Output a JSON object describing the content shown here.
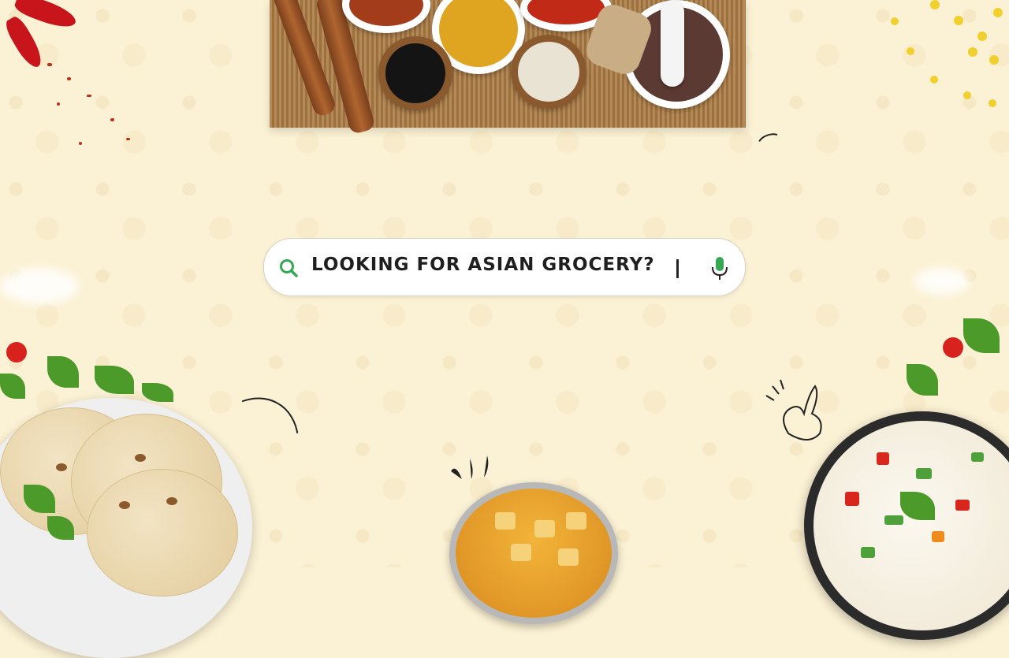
{
  "search": {
    "text": "LOOKING FOR ASIAN GROCERY?",
    "cursor": "|"
  },
  "icons": {
    "search": "search-icon",
    "mic": "microphone-icon"
  },
  "colors": {
    "background": "#fbf1d4",
    "search_icon": "#34a853",
    "mic_icon": "#34a853",
    "text": "#1f1f1f"
  }
}
